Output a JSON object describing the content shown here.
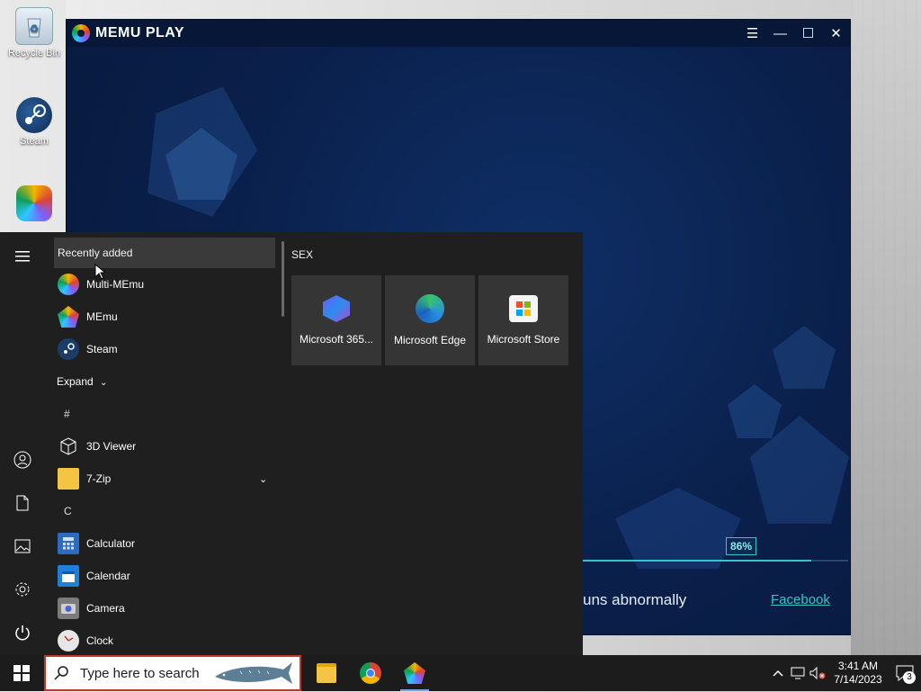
{
  "desktop": {
    "icons": [
      {
        "label": "Recycle Bin"
      },
      {
        "label": "Steam"
      },
      {
        "label": ""
      }
    ]
  },
  "memu": {
    "title": "MEMU PLAY",
    "progress_label": "86%",
    "progress_fraction": 0.86,
    "status_text": "uns abnormally",
    "facebook_link": "Facebook",
    "controls": {
      "menu_icon": "hamburger-icon",
      "minimize_icon": "minimize-icon",
      "maximize_icon": "maximize-icon",
      "close_icon": "close-icon"
    }
  },
  "start_menu": {
    "header": "Recently added",
    "recent": [
      {
        "label": "Multi-MEmu"
      },
      {
        "label": "MEmu"
      },
      {
        "label": "Steam"
      }
    ],
    "expand_label": "Expand",
    "section_hash": "#",
    "apps_hash": [
      {
        "label": "3D Viewer"
      },
      {
        "label": "7-Zip"
      }
    ],
    "section_c": "C",
    "apps_c": [
      {
        "label": "Calculator"
      },
      {
        "label": "Calendar"
      },
      {
        "label": "Camera"
      },
      {
        "label": "Clock"
      }
    ],
    "tile_group": "SEX",
    "tiles": [
      {
        "label": "Microsoft 365..."
      },
      {
        "label": "Microsoft Edge"
      },
      {
        "label": "Microsoft Store"
      }
    ]
  },
  "taskbar": {
    "search_placeholder": "Type here to search",
    "clock_time": "3:41 AM",
    "clock_date": "7/14/2023",
    "notification_count": "3"
  }
}
